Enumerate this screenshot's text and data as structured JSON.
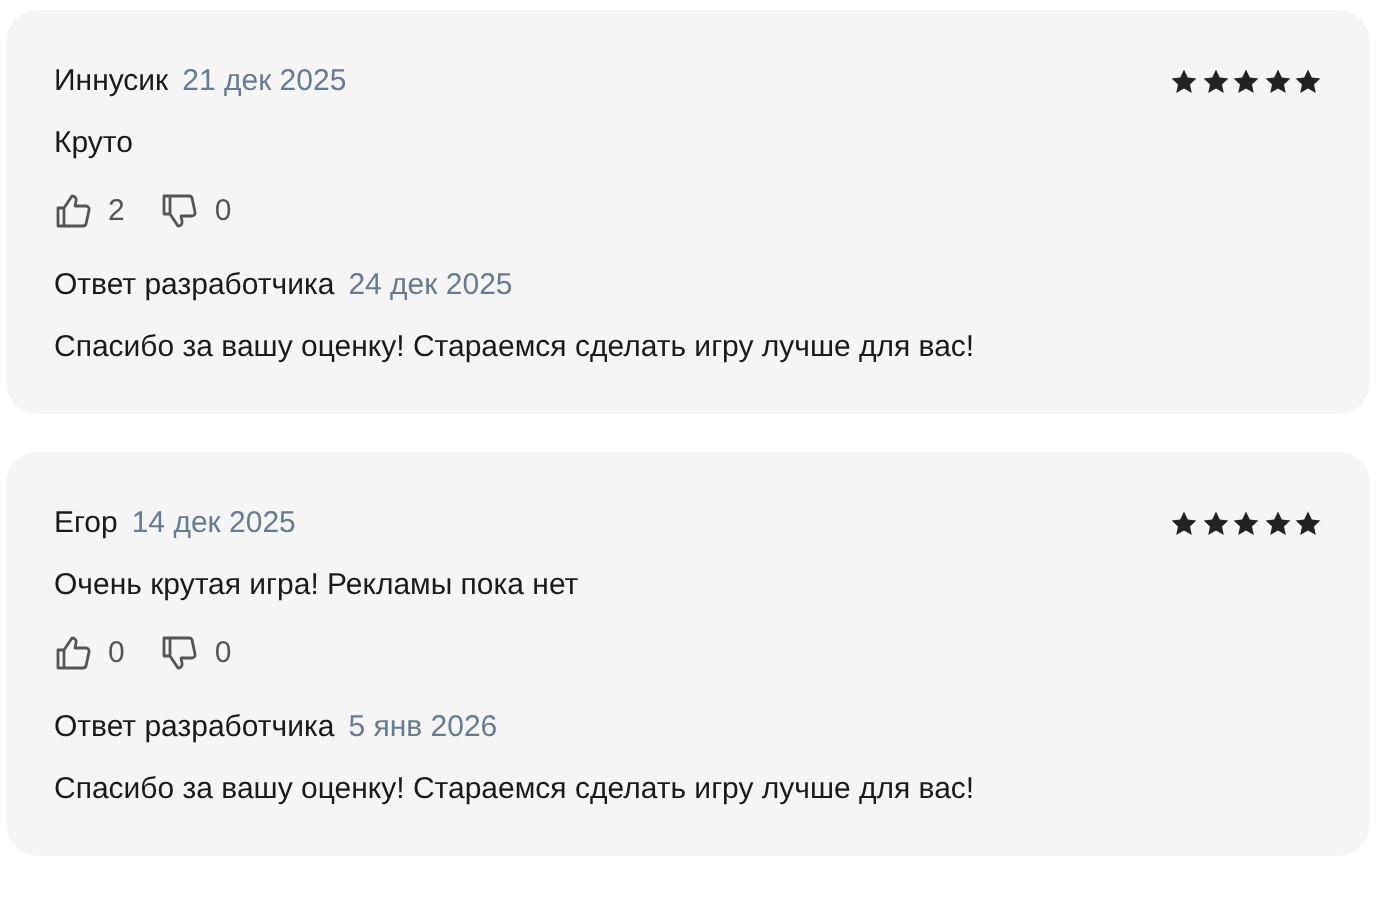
{
  "reviews": [
    {
      "author": "Иннусик",
      "date": "21 дек 2025",
      "stars": 5,
      "text": "Круто",
      "likes": "2",
      "dislikes": "0",
      "reply": {
        "title": "Ответ разработчика",
        "date": "24 дек 2025",
        "text": "Спасибо за вашу оценку! Стараемся сделать игру лучше для вас!"
      }
    },
    {
      "author": "Егор",
      "date": "14 дек 2025",
      "stars": 5,
      "text": "Очень крутая игра! Рекламы пока нет",
      "likes": "0",
      "dislikes": "0",
      "reply": {
        "title": "Ответ разработчика",
        "date": "5 янв 2026",
        "text": "Спасибо за вашу оценку! Стараемся сделать игру лучше для вас!"
      }
    }
  ]
}
